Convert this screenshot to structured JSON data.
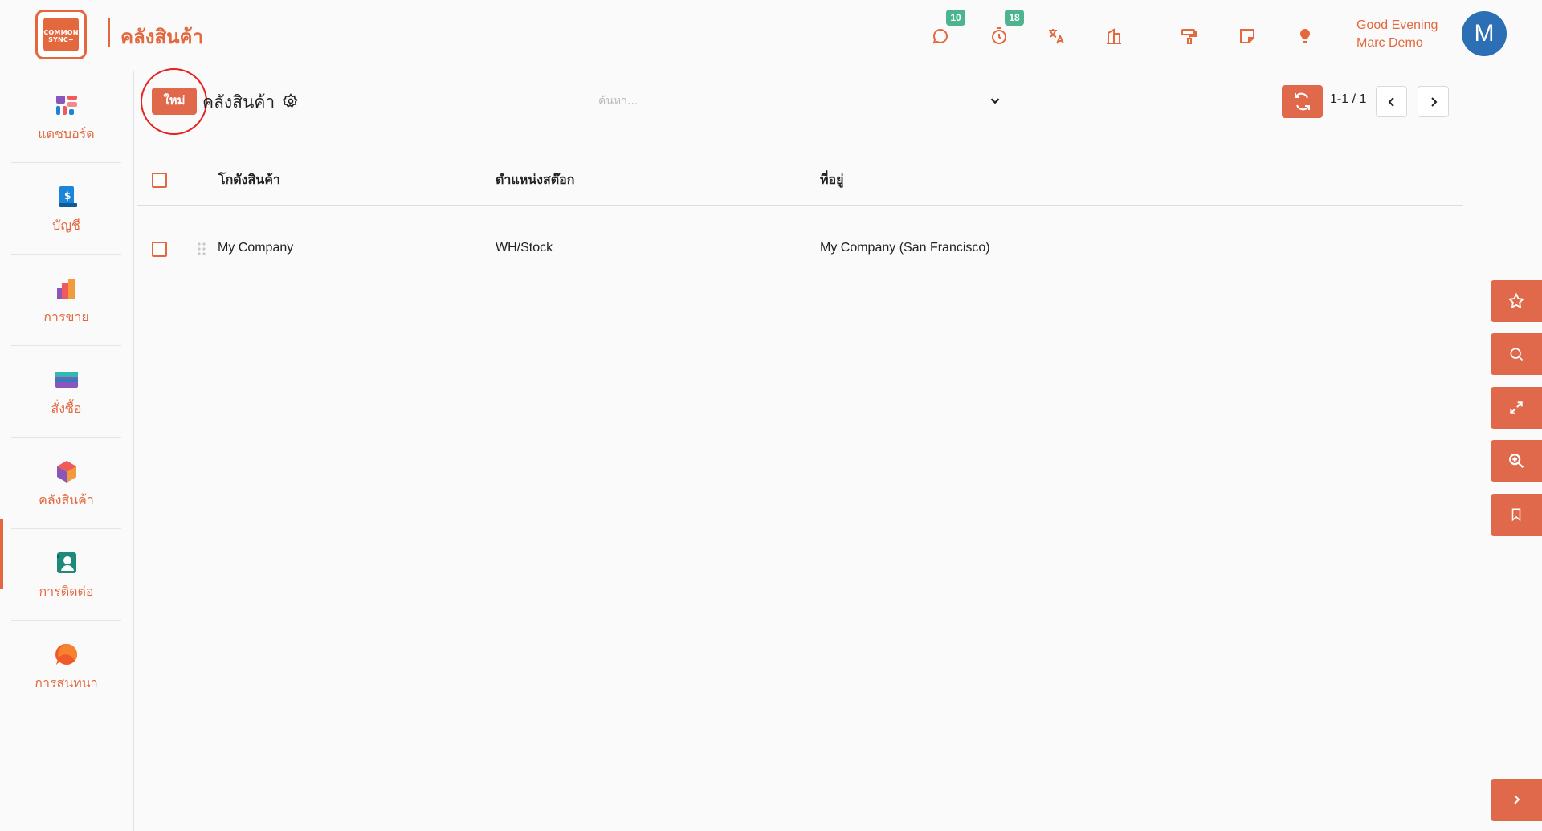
{
  "brand": {
    "logo_text": "COMMON SYNC+",
    "app_title": "คลังสินค้า"
  },
  "header": {
    "icons": [
      {
        "name": "chat-icon",
        "badge": "10"
      },
      {
        "name": "timer-icon",
        "badge": "18"
      },
      {
        "name": "translate-icon"
      },
      {
        "name": "company-icon"
      },
      {
        "name": "paint-roller-icon"
      },
      {
        "name": "sticky-note-icon"
      },
      {
        "name": "lightbulb-icon"
      }
    ],
    "greeting": "Good Evening",
    "user_name": "Marc Demo",
    "avatar_initial": "M"
  },
  "sidebar": {
    "items": [
      {
        "label": "แดชบอร์ด",
        "icon": "dashboard-icon"
      },
      {
        "label": "บัญชี",
        "icon": "invoice-icon"
      },
      {
        "label": "การขาย",
        "icon": "sales-chart-icon"
      },
      {
        "label": "สั่งซื้อ",
        "icon": "credit-card-icon"
      },
      {
        "label": "คลังสินค้า",
        "icon": "inventory-box-icon",
        "active": true
      },
      {
        "label": "การติดต่อ",
        "icon": "contact-card-icon"
      },
      {
        "label": "การสนทนา",
        "icon": "discuss-bubble-icon"
      }
    ]
  },
  "control": {
    "new_label": "ใหม่",
    "view_title": "คลังสินค้า",
    "search_placeholder": "ค้นหา...",
    "pager": "1-1 / 1"
  },
  "table": {
    "columns": [
      "โกดังสินค้า",
      "ตำแหน่งสต๊อก",
      "ที่อยู่"
    ],
    "rows": [
      {
        "warehouse": "My Company",
        "location": "WH/Stock",
        "address": "My Company (San Francisco)"
      }
    ]
  },
  "colors": {
    "accent": "#e4683e",
    "badge": "#4cb58f",
    "avatar": "#2c6fb4"
  }
}
